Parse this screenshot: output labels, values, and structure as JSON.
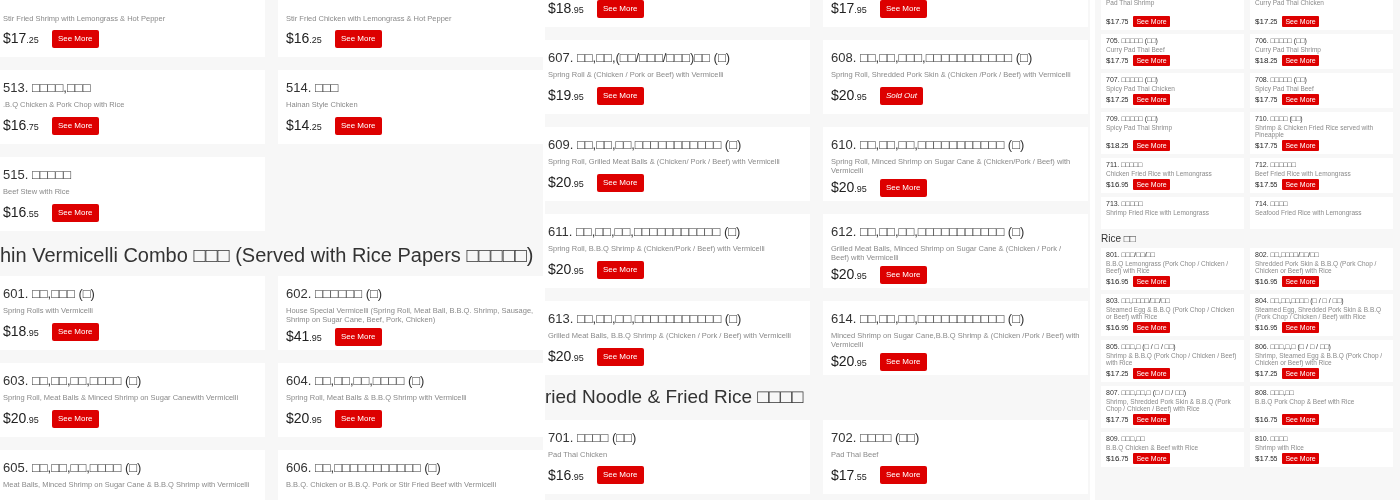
{
  "panels": [
    {
      "sections": [
        {
          "items": [
            {
              "desc": "Stir Fried Shrimp with Lemongrass & Hot Pepper",
              "price": "$17.25",
              "button": "See More",
              "sold_out": false
            },
            {
              "desc": "Stir Fried Chicken with Lemongrass & Hot Pepper",
              "price": "$16.25",
              "button": "See More",
              "sold_out": false
            },
            {
              "title": "513. □□□□,□□□",
              "desc": ".B.Q Chicken & Pork Chop with Rice",
              "price": "$16.75",
              "button": "See More",
              "sold_out": false
            },
            {
              "title": "514. □□□",
              "desc": "Hainan Style Chicken",
              "price": "$14.25",
              "button": "See More",
              "sold_out": false
            },
            {
              "title": "515. □□□□□",
              "desc": "Beef Stew with Rice",
              "price": "$16.55",
              "button": "See More",
              "sold_out": false
            }
          ]
        },
        {
          "heading": "hin Vermicelli Combo □□□ (Served with Rice Papers □□□□□)",
          "items": [
            {
              "title": "601. □□,□□□ (□)",
              "desc": "Spring Rolls with Vermicelli",
              "price": "$18.95",
              "button": "See More",
              "sold_out": false
            },
            {
              "title": "602. □□□□□□ (□)",
              "desc": "House Special Vermicelli (Spring Roll, Meat Ball, B.B.Q. Shrimp, Sausage, Shrimp on Sugar Cane, Beef, Pork, Chicken)",
              "price": "$41.95",
              "button": "See More",
              "sold_out": false
            },
            {
              "title": "603. □□,□□,□□,□□□□ (□)",
              "desc": "Spring Roll, Meat Balls & Minced Shrimp on Sugar Canewith Vermicelli",
              "price": "$20.95",
              "button": "See More",
              "sold_out": false
            },
            {
              "title": "604. □□,□□,□□,□□□□ (□)",
              "desc": "Spring Roll, Meat Balls & B.B.Q Shrimp with Vermicelli",
              "price": "$20.95",
              "button": "See More",
              "sold_out": false
            },
            {
              "title": "605. □□,□□,□□,□□□□ (□)",
              "desc": "Meat Balls, Minced Shrimp on Sugar Cane & B.B.Q Shrimp with Vermicelli"
            },
            {
              "title": "606. □□,□□□□□□□□□□□ (□)",
              "desc": "B.B.Q. Chicken or B.B.Q. Pork or Stir Fried Beef with Vermicelli"
            }
          ]
        }
      ]
    },
    {
      "sections": [
        {
          "items": [
            {
              "price": "$18.95",
              "button": "See More",
              "sold_out": false
            },
            {
              "price": "$17.95",
              "button": "See More",
              "sold_out": false
            },
            {
              "title": "607. □□,□□,(□□/□□□/□□□)□□ (□)",
              "desc": "Spring Roll & (Chicken / Pork or Beef) with Vermicelli",
              "price": "$19.95",
              "button": "See More",
              "sold_out": false
            },
            {
              "title": "608. □□,□□,□□□,□□□□□□□□□□□ (□)",
              "desc": "Spring Roll, Shredded Pork Skin & (Chicken /Pork / Beef) with Vermicelli",
              "price": "$20.95",
              "button": "Sold Out",
              "sold_out": true
            },
            {
              "title": "609. □□,□□,□□,□□□□□□□□□□□ (□)",
              "desc": "Spring Roll, Grilled Meat Balls & (Chicken/ Pork / Beef) with Vermicelli",
              "price": "$20.95",
              "button": "See More",
              "sold_out": false
            },
            {
              "title": "610. □□,□□,□□,□□□□□□□□□□□ (□)",
              "desc": "Spring Roll, Minced Shrimp on Sugar Cane & (Chicken/Pork / Beef) with Vermicelli",
              "price": "$20.95",
              "button": "See More",
              "sold_out": false
            },
            {
              "title": "611. □□,□□,□□,□□□□□□□□□□□ (□)",
              "desc": "Spring Roll, B.B.Q Shrimp & (Chicken/Pork / Beef) with Vermicelli",
              "price": "$20.95",
              "button": "See More",
              "sold_out": false
            },
            {
              "title": "612. □□,□□,□□,□□□□□□□□□□□ (□)",
              "desc": "Grilled Meat Balls, Minced Shrimp on Sugar Cane & (Chicken / Pork / Beef) with Vermicelli",
              "price": "$20.95",
              "button": "See More",
              "sold_out": false
            },
            {
              "title": "613. □□,□□,□□,□□□□□□□□□□□ (□)",
              "desc": "Grilled Meat Balls, B.B.Q Shrimp & (Chicken / Pork / Beef) with Vermicelli",
              "price": "$20.95",
              "button": "See More",
              "sold_out": false
            },
            {
              "title": "614. □□,□□,□□,□□□□□□□□□□□ (□)",
              "desc": "Minced Shrimp on Sugar Cane,B.B.Q Shrimp & (Chicken /Pork / Beef) with Vermicelli",
              "price": "$20.95",
              "button": "See More",
              "sold_out": false
            }
          ]
        },
        {
          "heading": "ried Noodle & Fried Rice □□□□",
          "items": [
            {
              "title": "701. □□□□ (□□)",
              "desc": "Pad Thai Chicken",
              "price": "$16.95",
              "button": "See More",
              "sold_out": false
            },
            {
              "title": "702. □□□□ (□□)",
              "desc": "Pad Thai Beef",
              "price": "$17.55",
              "button": "See More",
              "sold_out": false
            }
          ]
        }
      ]
    },
    {
      "sections": [
        {
          "items": [
            {
              "desc": "Pad Thai Shrimp",
              "price": "$17.75",
              "button": "See More",
              "sold_out": false
            },
            {
              "desc": "Curry Pad Thai Chicken",
              "price": "$17.25",
              "button": "See More",
              "sold_out": false
            },
            {
              "title": "705. □□□□□ (□□)",
              "desc": "Curry Pad Thai Beef",
              "price": "$17.75",
              "button": "See More",
              "sold_out": false
            },
            {
              "title": "706. □□□□□ (□□)",
              "desc": "Curry Pad Thai Shrimp",
              "price": "$18.25",
              "button": "See More",
              "sold_out": false
            },
            {
              "title": "707. □□□□□ (□□)",
              "desc": "Spicy Pad Thai Chicken",
              "price": "$17.25",
              "button": "See More",
              "sold_out": false
            },
            {
              "title": "708. □□□□□ (□□)",
              "desc": "Spicy Pad Thai Beef",
              "price": "$17.75",
              "button": "See More",
              "sold_out": false
            },
            {
              "title": "709. □□□□□ (□□)",
              "desc": "Spicy Pad Thai Shrimp",
              "price": "$18.25",
              "button": "See More",
              "sold_out": false
            },
            {
              "title": "710. □□□□ (□□)",
              "desc": "Shrimp & Chicken Fried Rice served with Pineapple",
              "price": "$17.75",
              "button": "See More",
              "sold_out": false
            },
            {
              "title": "711. □□□□□",
              "desc": "Chicken Fried Rice with Lemongrass",
              "price": "$16.95",
              "button": "See More",
              "sold_out": false
            },
            {
              "title": "712. □□□□□□",
              "desc": "Beef Fried Rice with Lemongrass",
              "price": "$17.55",
              "button": "See More",
              "sold_out": false
            },
            {
              "title": "713. □□□□□",
              "desc": "Shrimp Fried Rice with Lemongrass"
            },
            {
              "title": "714. □□□□",
              "desc": "Seafood Fried Rice with Lemongrass"
            }
          ]
        },
        {
          "heading": "Rice □□",
          "items": [
            {
              "title": "801. □□□/□□/□□",
              "desc": "B.B.Q Lemongrass (Pork Chop / Chicken / Beef) with Rice",
              "price": "$16.95",
              "button": "See More",
              "sold_out": false
            },
            {
              "title": "802. □□,□□□□/□□/□□",
              "desc": "Shredded Pork Skin & B.B.Q (Pork Chop / Chicken or Beef) with Rice",
              "price": "$16.95",
              "button": "See More",
              "sold_out": false
            },
            {
              "title": "803. □□,□□□□/□□/□□",
              "desc": "Steamed Egg & B.B.Q (Pork Chop / Chicken or Beef) with Rice",
              "price": "$16.95",
              "button": "See More",
              "sold_out": false
            },
            {
              "title": "804. □□,□□,□□□□ (□ / □ / □□)",
              "desc": "Steamed Egg, Shredded Pork Skin & B.B.Q (Pork Chop / Chicken / Beef) with Rice",
              "price": "$16.95",
              "button": "See More",
              "sold_out": false
            },
            {
              "title": "805. □□□,□ (□ / □ / □□)",
              "desc": "Shrimp & B.B.Q (Pork Chop / Chicken / Beef) with Rice",
              "price": "$17.25",
              "button": "See More",
              "sold_out": false
            },
            {
              "title": "806. □□□,□,□ (□ / □ / □□)",
              "desc": "Shrimp, Steamed Egg & B.B.Q (Pork Chop / Chicken or Beef) with Rice",
              "price": "$17.25",
              "button": "See More",
              "sold_out": false
            },
            {
              "title": "807. □□□,□□,□ (□ / □ / □□)",
              "desc": "Shrimp, Shredded Pork Skin & B.B.Q (Pork Chop / Chicken / Beef) with Rice",
              "price": "$17.75",
              "button": "See More",
              "sold_out": false
            },
            {
              "title": "808. □□□,□□",
              "desc": "B.B.Q Pork Chop & Beef with Rice",
              "price": "$16.75",
              "button": "See More",
              "sold_out": false
            },
            {
              "title": "809. □□□,□□",
              "desc": "B.B.Q Chicken & Beef with Rice",
              "price": "$16.75",
              "button": "See More",
              "sold_out": false
            },
            {
              "title": "810. □□□□",
              "desc": "Shrimp with Rice",
              "price": "$17.55",
              "button": "See More",
              "sold_out": false
            }
          ]
        }
      ]
    }
  ]
}
